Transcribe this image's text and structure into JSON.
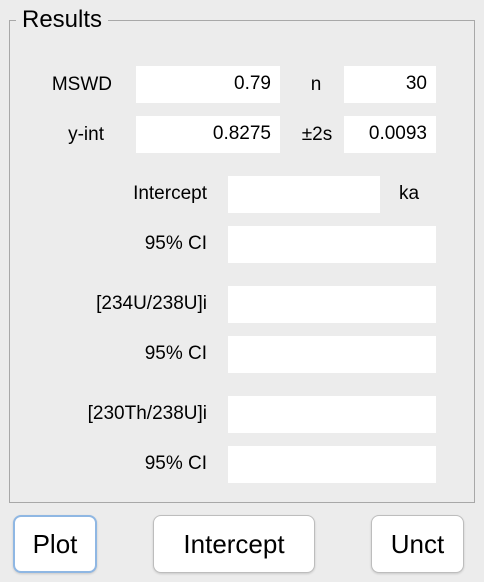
{
  "panel": {
    "title": "Results"
  },
  "stats": {
    "mswd_label": "MSWD",
    "mswd_value": "0.79",
    "n_label": "n",
    "n_value": "30",
    "yint_label": "y-int",
    "yint_value": "0.8275",
    "err_label": "±2s",
    "err_value": "0.0093"
  },
  "results": {
    "intercept_label": "Intercept",
    "intercept_value": "",
    "intercept_unit": "ka",
    "ci1_label": "95% CI",
    "ci1_value": "",
    "u234_label": "[234U/238U]i",
    "u234_value": "",
    "ci2_label": "95% CI",
    "ci2_value": "",
    "th230_label": "[230Th/238U]i",
    "th230_value": "",
    "ci3_label": "95% CI",
    "ci3_value": ""
  },
  "buttons": {
    "plot": "Plot",
    "intercept": "Intercept",
    "unct": "Unct"
  }
}
